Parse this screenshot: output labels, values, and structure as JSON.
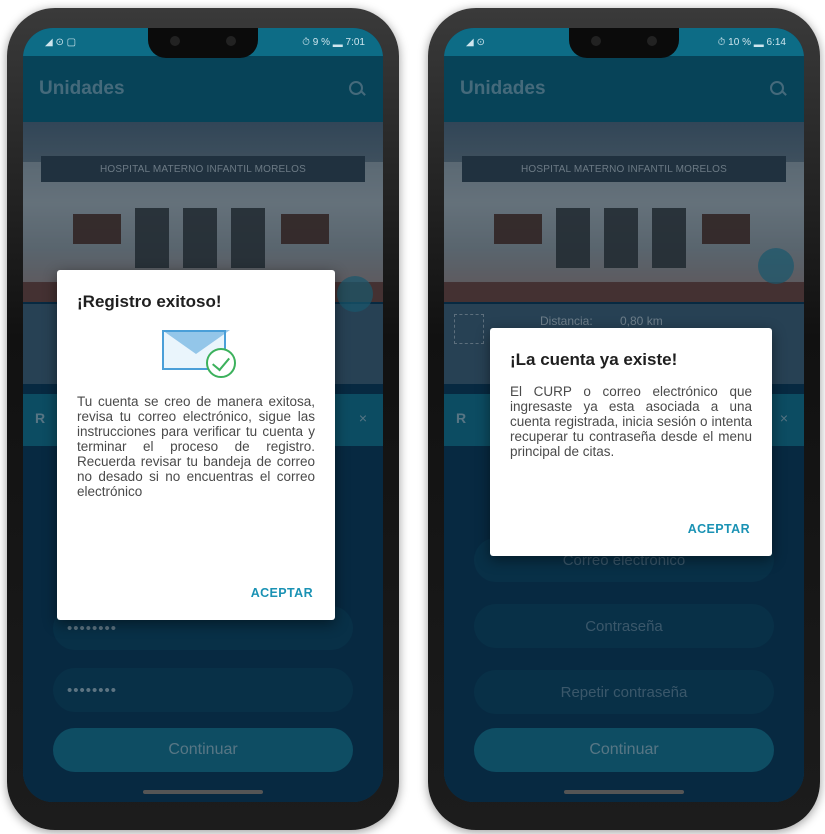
{
  "left_phone": {
    "status_left": "◢ ⊙ ▢",
    "status_right": "⏱ 9 % ▂ 7:01",
    "app_title": "Unidades",
    "sign_text": "HOSPITAL MATERNO INFANTIL MORELOS",
    "section_initial": "R",
    "close_glyph": "×",
    "password_mask_1": "••••••••",
    "password_mask_2": "••••••••",
    "continue_label": "Continuar",
    "dialog": {
      "title": "¡Registro exitoso!",
      "body": "Tu cuenta se creo de manera exitosa, revisa tu correo electrónico, sigue las instrucciones para verificar tu cuenta y terminar el proceso de registro. Recuerda revisar tu bandeja de correo no desado si no encuentras el correo electrónico",
      "accept": "ACEPTAR"
    }
  },
  "right_phone": {
    "status_left": "◢ ⊙",
    "status_right": "⏱ 10 % ▂ 6:14",
    "app_title": "Unidades",
    "sign_text": "HOSPITAL MATERNO INFANTIL MORELOS",
    "distance_label": "Distancia:",
    "distance_value": "0,80 km",
    "section_initial": "R",
    "close_glyph": "×",
    "email_placeholder": "Correo electrónico",
    "password_placeholder": "Contraseña",
    "repeat_password_placeholder": "Repetir contraseña",
    "continue_label": "Continuar",
    "dialog": {
      "title": "¡La cuenta ya existe!",
      "body": "El CURP o correo electrónico que ingresaste ya esta asociada a una cuenta registrada, inicia sesión o intenta recuperar tu contraseña desde el menu principal de citas.",
      "accept": "ACEPTAR"
    }
  },
  "colors": {
    "accent": "#1a92b4",
    "appbar": "#0e6a84",
    "success": "#3cb15c",
    "mail": "#4b9fd8"
  }
}
